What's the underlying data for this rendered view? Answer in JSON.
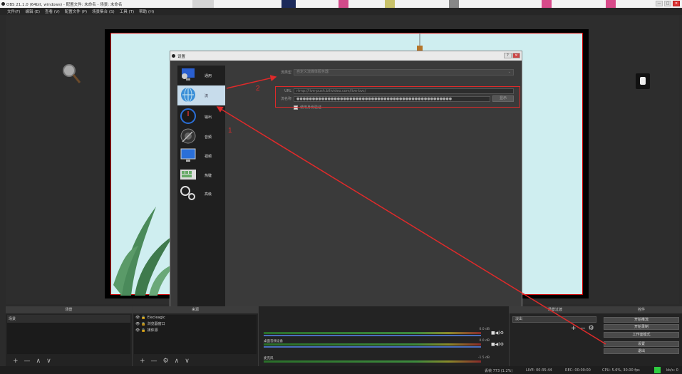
{
  "window": {
    "title": "OBS 21.1.0 (64bit, windows) - 配置文件: 未命名 - 场景: 未命名",
    "min": "—",
    "max": "□",
    "close": "✕"
  },
  "menu": [
    "文件(F)",
    "编辑 (E)",
    "查看 (V)",
    "配置文件 (P)",
    "场景集合 (S)",
    "工具 (T)",
    "帮助 (H)"
  ],
  "dialog": {
    "title": "设置",
    "min": "?",
    "close": "✕",
    "sidebar": [
      {
        "label": "通用",
        "icon": "gear-monitor-icon"
      },
      {
        "label": "流",
        "icon": "globe-stream-icon"
      },
      {
        "label": "输出",
        "icon": "output-gauge-icon"
      },
      {
        "label": "音频",
        "icon": "speaker-icon"
      },
      {
        "label": "视频",
        "icon": "monitor-icon"
      },
      {
        "label": "热键",
        "icon": "keyboard-icon"
      },
      {
        "label": "高级",
        "icon": "gears-icon"
      }
    ],
    "stream": {
      "service_label": "流类型",
      "service_value": "自定义流媒体服务器",
      "url_label": "URL",
      "url_value": "rtmp://live-push.bilivideo.com/live-bvc/",
      "key_label": "流名称",
      "key_value": "●●●●●●●●●●●●●●●●●●●●●●●●●●●●●●●●●●●●●●●●●●●●●●●●●●",
      "show_button": "显示",
      "auth_label": "使用身份验证"
    },
    "buttons": {
      "ok": "确定",
      "cancel": "取消",
      "apply": "应用"
    }
  },
  "annotations": {
    "one": "1",
    "two": "2"
  },
  "docks": {
    "scenes": {
      "title": "场景",
      "items": [
        "场景"
      ]
    },
    "sources": {
      "title": "来源",
      "items": [
        "Elecleagic",
        "浏览器窗口",
        "媒体源"
      ]
    },
    "mixer": [
      {
        "label": "",
        "db": "0.0 dB"
      },
      {
        "label": "桌面音频设备",
        "db": "0.0 dB"
      },
      {
        "label": "麦克风",
        "db": "-1.5 dB"
      }
    ],
    "transitions": {
      "title": "场景过渡",
      "value": "淡出"
    },
    "controls": {
      "title": "控件",
      "buttons": [
        "开始推流",
        "开始录制",
        "工作室模式",
        "设置",
        "退出"
      ]
    }
  },
  "toolbar_symbols": {
    "add": "+",
    "remove": "—",
    "up": "∧",
    "down": "∨",
    "gear": "⚙"
  },
  "status": {
    "dropped": "丢帧 773 (1.2%)",
    "live": "LIVE: 00:35:44",
    "rec": "REC: 00:00:00",
    "cpu": "CPU: 5.6%, 30.00 fps",
    "bitrate": "kb/s: 0"
  },
  "colors": {
    "accent_red": "#e02a2a",
    "status_green": "#2ecc40",
    "active_sidebar": "#c7dceb"
  }
}
